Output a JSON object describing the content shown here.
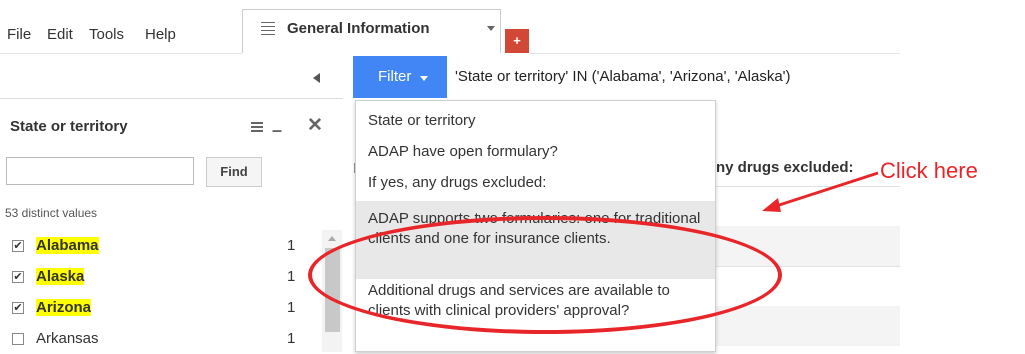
{
  "menu": [
    "File",
    "Edit",
    "Tools",
    "Help"
  ],
  "tab": {
    "title": "General Information"
  },
  "add_tab_label": "+",
  "filter": {
    "button_label": "Filter",
    "expression": "'State or territory' IN ('Alabama', 'Arizona', 'Alaska')"
  },
  "panel": {
    "title": "State or territory",
    "search_value": "",
    "find_label": "Find",
    "distinct_text": "53 distinct values",
    "values": [
      {
        "label": "Alabama",
        "count": "1",
        "checked": true
      },
      {
        "label": "Alaska",
        "count": "1",
        "checked": true
      },
      {
        "label": "Arizona",
        "count": "1",
        "checked": true
      },
      {
        "label": "Arkansas",
        "count": "1",
        "checked": false
      }
    ]
  },
  "table": {
    "stub_text": "I",
    "visible_header": "ny drugs excluded:"
  },
  "dropdown": {
    "items": [
      "State or territory",
      "ADAP have open formulary?",
      "If yes, any drugs excluded:",
      "ADAP supports two formularies: one for traditional clients and one for insurance clients.",
      "Additional drugs and services are available to clients with clinical providers' approval?"
    ],
    "active_index": 3
  },
  "annotation": {
    "label": "Click here",
    "color": "#e8262a"
  },
  "colors": {
    "accent": "#4285f4",
    "highlight": "#ffff00",
    "add_tab": "#d14836"
  }
}
